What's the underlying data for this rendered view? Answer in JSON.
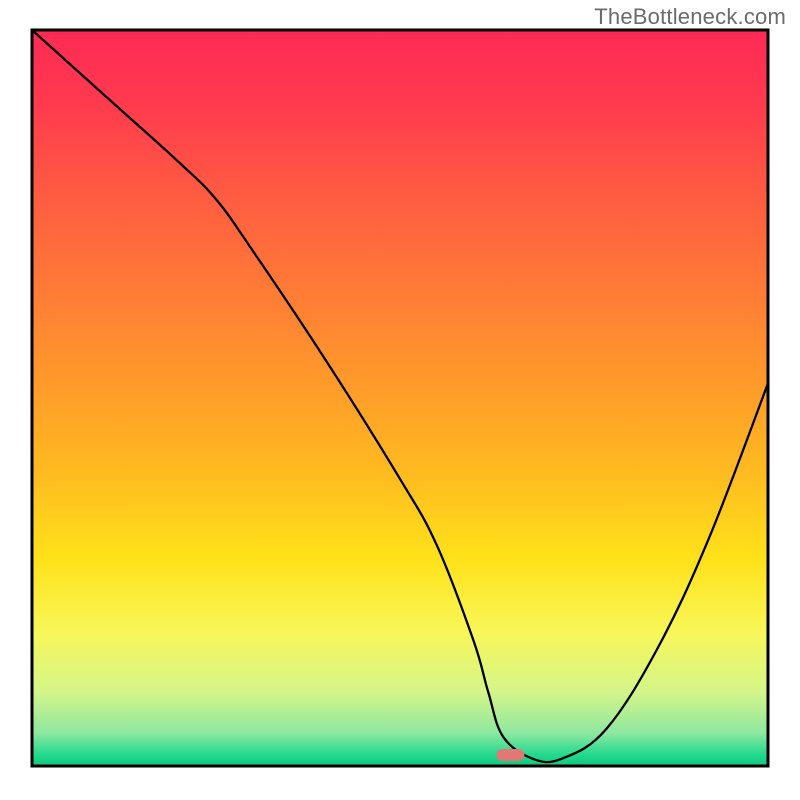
{
  "watermark": "TheBottleneck.com",
  "chart_data": {
    "type": "line",
    "title": "",
    "xlabel": "",
    "ylabel": "",
    "xlim": [
      0,
      100
    ],
    "ylim": [
      0,
      100
    ],
    "x": [
      0,
      10,
      20,
      25,
      30,
      40,
      50,
      55,
      60,
      62,
      64,
      68,
      72,
      78,
      85,
      92,
      100
    ],
    "values": [
      100,
      91,
      82,
      77,
      70,
      55,
      39,
      30,
      17,
      10,
      4,
      1,
      1,
      5,
      16,
      31,
      52
    ],
    "curve_color": "#000000",
    "curve_width": 2.3,
    "marker": {
      "x": 65,
      "y": 1.5,
      "color": "#e27876",
      "rx": 14,
      "ry": 6
    },
    "axes": {
      "show_box": true,
      "stroke": "#000000",
      "stroke_width": 3
    },
    "background_gradient": {
      "stops": [
        {
          "offset": 0.0,
          "color": "#ff2a55"
        },
        {
          "offset": 0.1,
          "color": "#ff3a4e"
        },
        {
          "offset": 0.22,
          "color": "#ff5a42"
        },
        {
          "offset": 0.35,
          "color": "#ff7a36"
        },
        {
          "offset": 0.48,
          "color": "#ff9a2a"
        },
        {
          "offset": 0.6,
          "color": "#ffba20"
        },
        {
          "offset": 0.72,
          "color": "#ffe21a"
        },
        {
          "offset": 0.82,
          "color": "#f7f75a"
        },
        {
          "offset": 0.9,
          "color": "#d4f58a"
        },
        {
          "offset": 0.955,
          "color": "#8ee8a0"
        },
        {
          "offset": 0.985,
          "color": "#22d98e"
        },
        {
          "offset": 1.0,
          "color": "#10c97e"
        }
      ]
    }
  }
}
